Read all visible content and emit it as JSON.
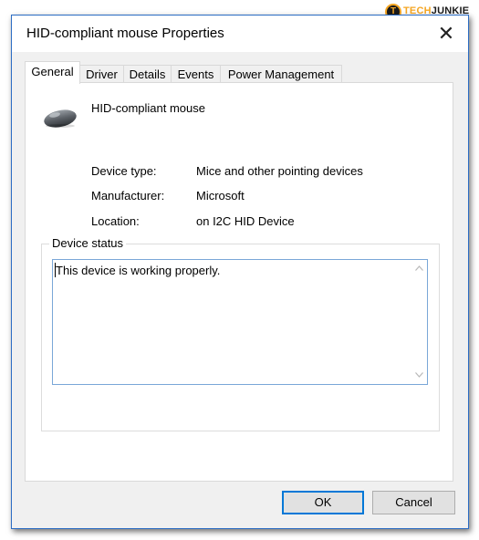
{
  "window": {
    "title": "HID-compliant mouse Properties",
    "close_glyph": "✕"
  },
  "tabs": [
    {
      "label": "General",
      "active": true
    },
    {
      "label": "Driver",
      "active": false
    },
    {
      "label": "Details",
      "active": false
    },
    {
      "label": "Events",
      "active": false
    },
    {
      "label": "Power Management",
      "active": false
    }
  ],
  "device": {
    "name": "HID-compliant mouse",
    "icon": "mouse-icon"
  },
  "properties": [
    {
      "label": "Device type:",
      "value": "Mice and other pointing devices"
    },
    {
      "label": "Manufacturer:",
      "value": "Microsoft"
    },
    {
      "label": "Location:",
      "value": "on I2C HID Device"
    }
  ],
  "status": {
    "group_label": "Device status",
    "text": "This device is working properly."
  },
  "buttons": {
    "ok": "OK",
    "cancel": "Cancel"
  },
  "watermark": {
    "badge": "T",
    "brand_part1": "TECH",
    "brand_part2": "JUNKIE"
  },
  "colors": {
    "accent": "#0078d7",
    "window_border": "#2b6cc4",
    "logo_orange": "#f5a623"
  }
}
